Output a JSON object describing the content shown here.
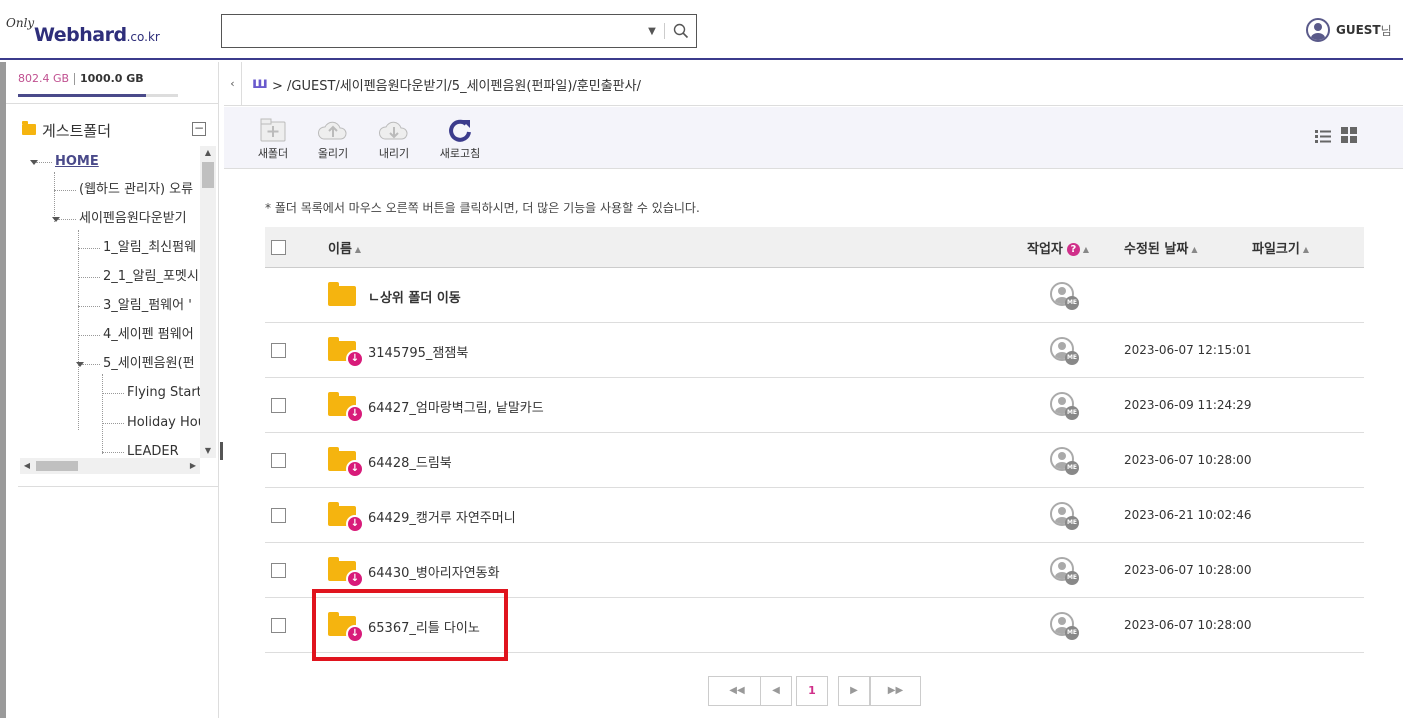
{
  "logo": {
    "only": "Only",
    "web": "Webhard",
    "domain": ".co.kr"
  },
  "search": {
    "value": "",
    "placeholder": ""
  },
  "user": {
    "name": "GUEST",
    "suffix": "님"
  },
  "quota": {
    "used": "802.4 GB",
    "total": "1000.0 GB",
    "used_fraction": 0.8
  },
  "sidebar": {
    "title": "게스트폴더",
    "collapse": "−",
    "tree": {
      "home": "HOME",
      "items": [
        "(웹하드 관리자) 오류",
        "세이펜음원다운받기",
        "1_알림_최신펌웨",
        "2_1_알림_포멧시",
        "3_알림_펌웨어 '",
        "4_세이펜 펌웨어",
        "5_세이펜음원(펀",
        "Flying Start",
        "Holiday Hou",
        "LEADER"
      ]
    }
  },
  "breadcrumb": {
    "collapse": "‹",
    "brand": "ш",
    "path": "> /GUEST/세이펜음원다운받기/5_세이펜음원(펀파일)/훈민출판사/"
  },
  "toolbar": {
    "new_folder": "새폴더",
    "upload": "올리기",
    "download": "내리기",
    "refresh": "새로고침"
  },
  "notice": "* 폴더 목록에서 마우스 오른쪽 버튼을 클릭하시면, 더 많은 기능을 사용할 수 있습니다.",
  "table": {
    "headers": {
      "name": "이름",
      "owner": "작업자",
      "modified": "수정된 날짜",
      "size": "파일크기"
    },
    "up_row": {
      "name": "ㄴ상위 폴더 이동"
    },
    "rows": [
      {
        "name": "3145795_잼잼북",
        "date": "2023-06-07 12:15:01"
      },
      {
        "name": "64427_엄마랑벽그림, 낱말카드",
        "date": "2023-06-09 11:24:29"
      },
      {
        "name": "64428_드림북",
        "date": "2023-06-07 10:28:00"
      },
      {
        "name": "64429_캥거루 자연주머니",
        "date": "2023-06-21 10:02:46"
      },
      {
        "name": "64430_병아리자연동화",
        "date": "2023-06-07 10:28:00"
      },
      {
        "name": "65367_리틀 다이노",
        "date": "2023-06-07 10:28:00"
      }
    ],
    "owner_badge": "ME"
  },
  "pager": {
    "first": "◀◀",
    "prev": "◀",
    "current": "1",
    "next": "▶",
    "last": "▶▶"
  },
  "colors": {
    "brand": "#2e2e7a",
    "accent": "#d0308a",
    "folder": "#f5b40f",
    "highlight": "#e0141e"
  }
}
